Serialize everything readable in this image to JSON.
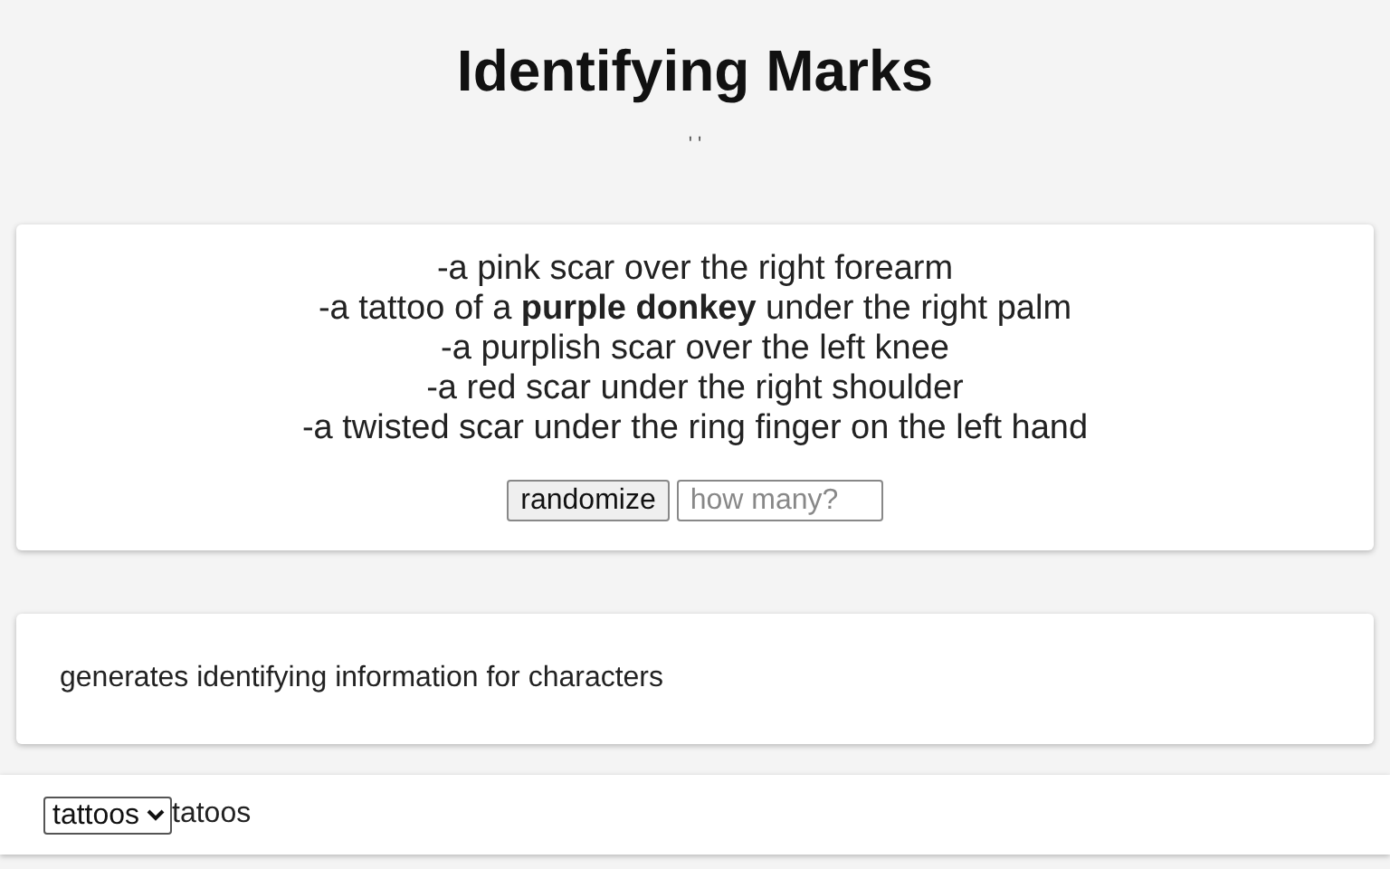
{
  "title": "Identifying Marks",
  "subtitle": "' '",
  "marks": [
    "-a pink scar over the right forearm",
    "-a tattoo of a **purple donkey** under the right palm",
    "-a purplish scar over the left knee",
    "-a red scar under the right shoulder",
    "-a twisted scar under the ring finger on the left hand"
  ],
  "randomize_button": "randomize",
  "count_field": {
    "placeholder": "how many?"
  },
  "description": "generates identifying information for characters",
  "footer": {
    "select_value": "tattoos",
    "label": "tatoos"
  }
}
